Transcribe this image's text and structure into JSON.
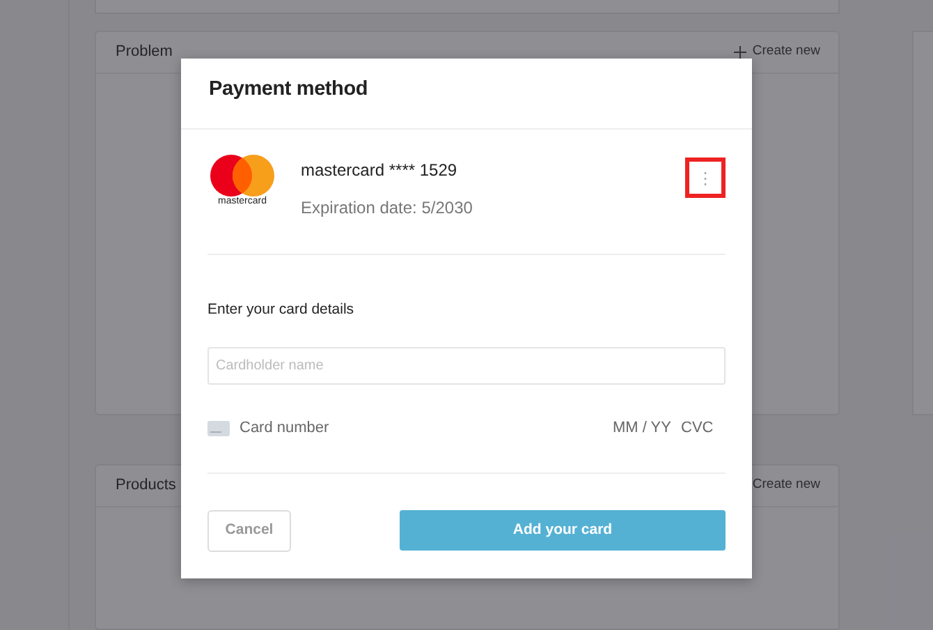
{
  "background_panels": [
    {
      "title": "Problem",
      "action": {
        "label": "Create new",
        "show_plus": true
      }
    },
    {
      "title": "Products",
      "action": {
        "label": "Create new",
        "show_plus": false
      }
    }
  ],
  "modal": {
    "title": "Payment method",
    "saved_card": {
      "brand_logo_text": "mastercard",
      "name": "mastercard **** 1529",
      "expiration": "Expiration date: 5/2030",
      "menu_button": {
        "label": "⋮",
        "highlighted": true
      }
    },
    "form": {
      "heading": "Enter your card details",
      "cardholder": {
        "placeholder": "Cardholder name"
      },
      "card_number": {
        "placeholder": "Card number"
      },
      "expiry": {
        "placeholder": "MM / YY"
      },
      "cvc": {
        "placeholder": "CVC"
      }
    },
    "buttons": [
      {
        "kind": "secondary",
        "label": "Cancel"
      },
      {
        "kind": "primary",
        "label": "Add your card"
      }
    ]
  }
}
